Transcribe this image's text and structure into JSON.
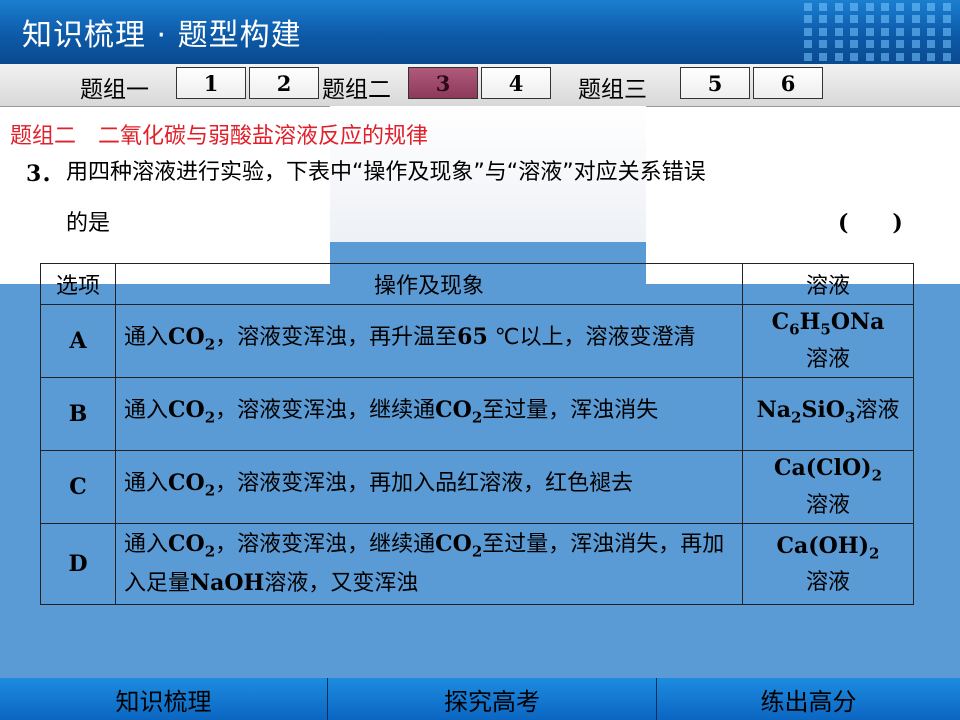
{
  "header": {
    "title": "知识梳理 · 题型构建"
  },
  "tabbar": {
    "groups": [
      {
        "label": "题组一",
        "tabs": [
          "1",
          "2"
        ]
      },
      {
        "label": "题组二",
        "tabs": [
          "3",
          "4"
        ]
      },
      {
        "label": "题组三",
        "tabs": [
          "5",
          "6"
        ]
      }
    ],
    "active_tab": "3"
  },
  "content": {
    "section_title": "题组二　二氧化碳与弱酸盐溶液反应的规律",
    "question_number": "3．",
    "question_line1": "用四种溶液进行实验，下表中“操作及现象”与“溶液”对应关系错误",
    "question_line2": "的是",
    "answer_paren": "(　　)"
  },
  "table": {
    "headers": [
      "选项",
      "操作及现象",
      "溶液"
    ],
    "rows": [
      {
        "option": "A",
        "desc_parts": [
          "通入",
          "CO",
          "2",
          "，溶液变浑浊，再升温至",
          "65",
          " ℃以上，溶液变澄清"
        ],
        "solution_parts": [
          "C",
          "6",
          "H",
          "5",
          "ONa",
          "溶液"
        ]
      },
      {
        "option": "B",
        "desc_parts": [
          "通入",
          "CO",
          "2",
          "，溶液变浑浊，继续通",
          "CO",
          "2",
          "至过量，浑浊消失"
        ],
        "solution_parts": [
          "Na",
          "2",
          "SiO",
          "3",
          "溶液"
        ]
      },
      {
        "option": "C",
        "desc_parts": [
          "通入",
          "CO",
          "2",
          "，溶液变浑浊，再加入品红溶液，红色褪去"
        ],
        "solution_parts": [
          "Ca(ClO)",
          "2",
          "溶液"
        ]
      },
      {
        "option": "D",
        "desc_parts": [
          "通入",
          "CO",
          "2",
          "，溶液变浑浊，继续通",
          "CO",
          "2",
          "至过量，浑浊消失，再加入足量",
          "NaOH",
          "溶液，又变浑浊"
        ],
        "solution_parts": [
          "Ca(OH)",
          "2",
          "溶液"
        ]
      }
    ]
  },
  "footer": {
    "items": [
      "知识梳理",
      "探究高考",
      "练出高分"
    ]
  },
  "colors": {
    "header_blue": "#0d5aa8",
    "section_red": "#e0202a",
    "table_bg_blue": "#5b9bd5",
    "active_tab": "#8d3a5a",
    "footer_blue": "#0b66c2"
  }
}
